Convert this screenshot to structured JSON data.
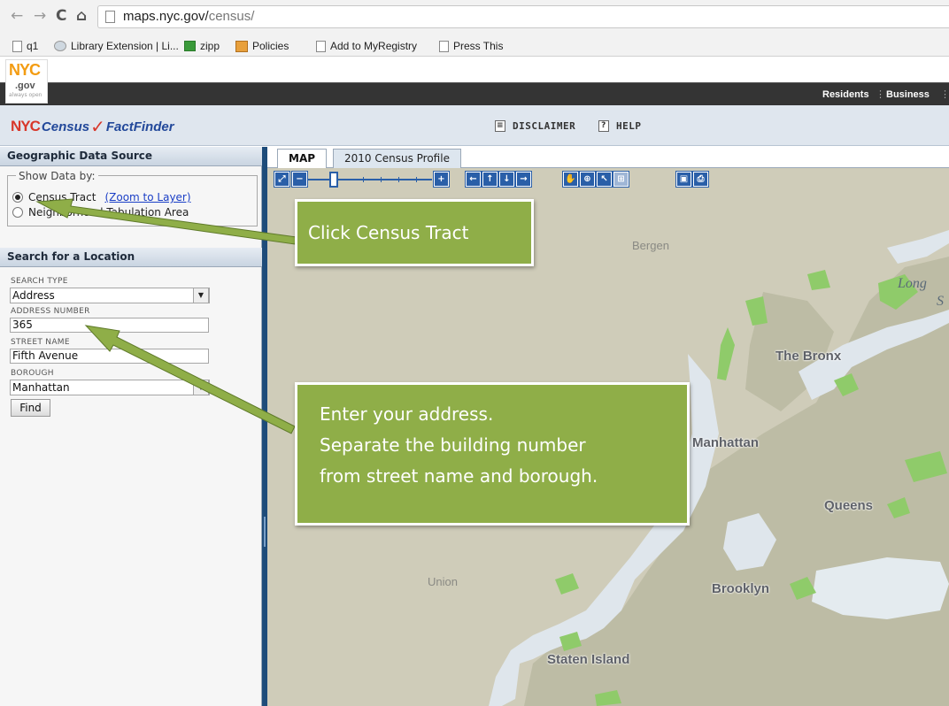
{
  "browser": {
    "url_host": "maps.nyc.gov/",
    "url_path": "census/",
    "back_icon": "back-arrow-icon",
    "forward_icon": "forward-arrow-icon",
    "reload_icon": "reload-icon",
    "home_icon": "home-icon",
    "bookmarks": [
      {
        "label": "q1",
        "icon": "page-icon"
      },
      {
        "label": "Library Extension | Li...",
        "icon": "library-icon"
      },
      {
        "label": "zipp",
        "icon": "spreadsheet-icon"
      },
      {
        "label": "Policies",
        "icon": "policies-icon"
      },
      {
        "label": "Add to MyRegistry",
        "icon": "page-icon"
      },
      {
        "label": "Press This",
        "icon": "page-icon"
      }
    ]
  },
  "nyc_header": {
    "logo_text": "NYC",
    "logo_sub": ".gov",
    "logo_tagline": "always open",
    "links": [
      "Residents",
      "Business"
    ]
  },
  "app_header": {
    "logo_nyc": "NYC",
    "logo_census": "Census",
    "logo_check": "✓",
    "logo_factfinder": "FactFinder",
    "disclaimer_label": "DISCLAIMER",
    "help_label": "HELP"
  },
  "left_panel": {
    "geo_header": "Geographic Data Source",
    "show_data_by": "Show Data by:",
    "radio_tract_label": "Census Tract",
    "zoom_link": "(Zoom to Layer)",
    "radio_nta_label": "Neighborhood Tabulation Area",
    "search_header": "Search for a Location",
    "search_type_label": "SEARCH TYPE",
    "search_type_value": "Address",
    "address_number_label": "ADDRESS NUMBER",
    "address_number_value": "365",
    "street_name_label": "STREET NAME",
    "street_name_value": "Fifth Avenue",
    "borough_label": "BOROUGH",
    "borough_value": "Manhattan",
    "find_label": "Find"
  },
  "tabs": [
    {
      "label": "MAP",
      "active": true
    },
    {
      "label": "2010 Census Profile",
      "active": false
    }
  ],
  "map_labels": {
    "bergen": "Bergen",
    "long_island_sound_1": "Long",
    "long_island_sound_2": "S",
    "bronx": "The Bronx",
    "manhattan": "Manhattan",
    "queens": "Queens",
    "union": "Union",
    "brooklyn": "Brooklyn",
    "staten_island": "Staten Island"
  },
  "callouts": {
    "census_tract": "Click Census Tract",
    "address_line1": "Enter your address.",
    "address_line2": "Separate the building number",
    "address_line3": "from street name and borough."
  },
  "colors": {
    "callout_green": "#8fae48",
    "map_land": "#cfccb9",
    "borough_land": "#bdbca5",
    "park_green": "#8fcb6a",
    "water": "#dfe6ec",
    "splitter_blue": "#1e4c7a"
  }
}
